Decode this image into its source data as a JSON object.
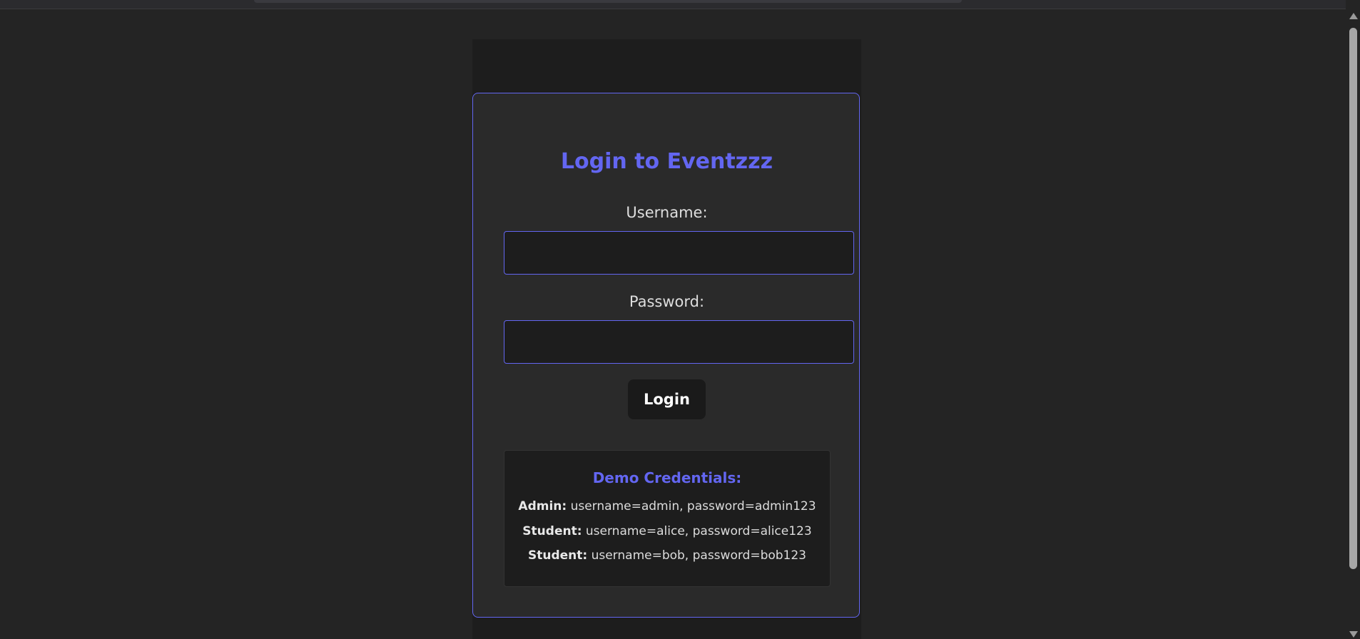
{
  "login": {
    "title": "Login to Eventzzz",
    "username_label": "Username:",
    "username_value": "",
    "password_label": "Password:",
    "password_value": "",
    "button_label": "Login"
  },
  "demo": {
    "title": "Demo Credentials:",
    "credentials": [
      {
        "role": "Admin:",
        "details": " username=admin, password=admin123"
      },
      {
        "role": "Student:",
        "details": " username=alice, password=alice123"
      },
      {
        "role": "Student:",
        "details": " username=bob, password=bob123"
      }
    ]
  },
  "colors": {
    "accent": "#6366f1",
    "background": "#242424",
    "card": "#2a2a2a",
    "input": "#1d1d1d"
  }
}
